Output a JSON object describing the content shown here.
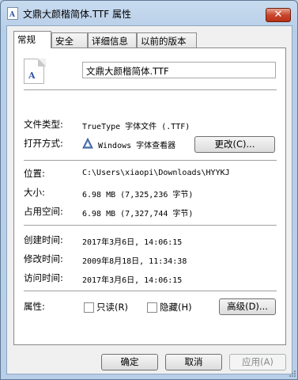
{
  "window": {
    "title": "文鼎大颜楷简体.TTF 属性",
    "close_label": "✕"
  },
  "tabs": [
    {
      "label": "常规"
    },
    {
      "label": "安全"
    },
    {
      "label": "详细信息"
    },
    {
      "label": "以前的版本"
    }
  ],
  "file": {
    "name": "文鼎大颜楷简体.TTF",
    "icon_glyph": "A"
  },
  "rows": {
    "type_label": "文件类型:",
    "type_value": "TrueType 字体文件 (.TTF)",
    "open_label": "打开方式:",
    "open_value": "Windows 字体查看器",
    "change_button": "更改(C)...",
    "location_label": "位置:",
    "location_value": "C:\\Users\\xiaopi\\Downloads\\HYYKJ",
    "size_label": "大小:",
    "size_value": "6.98 MB (7,325,236 字节)",
    "disk_label": "占用空间:",
    "disk_value": "6.98 MB (7,327,744 字节)",
    "created_label": "创建时间:",
    "created_value": "2017年3月6日, 14:06:15",
    "modified_label": "修改时间:",
    "modified_value": "2009年8月18日, 11:34:38",
    "accessed_label": "访问时间:",
    "accessed_value": "2017年3月6日, 14:06:15",
    "attr_label": "属性:",
    "readonly_label": "只读(R)",
    "hidden_label": "隐藏(H)",
    "advanced_button": "高级(D)..."
  },
  "buttons": {
    "ok": "确定",
    "cancel": "取消",
    "apply": "应用(A)"
  }
}
